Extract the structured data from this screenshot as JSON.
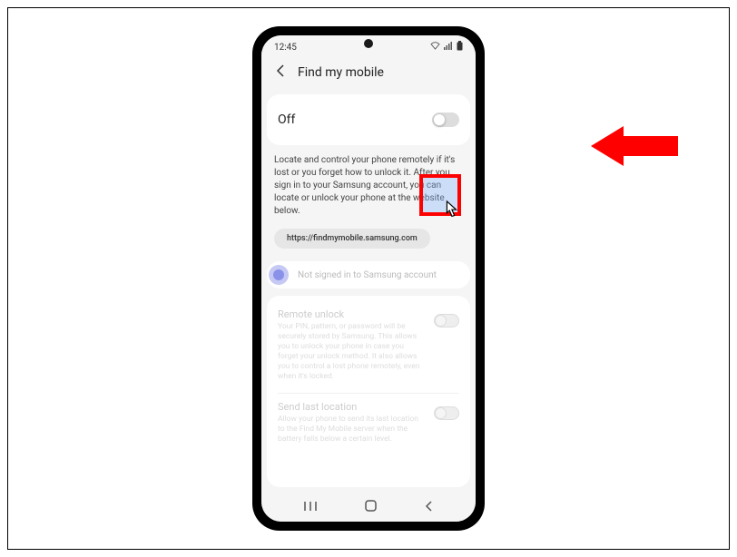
{
  "statusbar": {
    "time": "12:45"
  },
  "header": {
    "title": "Find my mobile"
  },
  "main_toggle": {
    "state_label": "Off"
  },
  "description": "Locate and control your phone remotely if it's lost or you forget how to unlock it. After you sign in to your Samsung account, you can locate or unlock your phone at the website below.",
  "url": "https://findmymobile.samsung.com",
  "account": {
    "status": "Not signed in to Samsung account"
  },
  "settings": [
    {
      "title": "Remote unlock",
      "desc": "Your PIN, pattern, or password will be securely stored by Samsung. This allows you to unlock your phone in case you forget your unlock method. It also allows you to control a lost phone remotely, even when it's locked."
    },
    {
      "title": "Send last location",
      "desc": "Allow your phone to send its last location to the Find My Mobile server when the battery falls below a certain level."
    }
  ]
}
